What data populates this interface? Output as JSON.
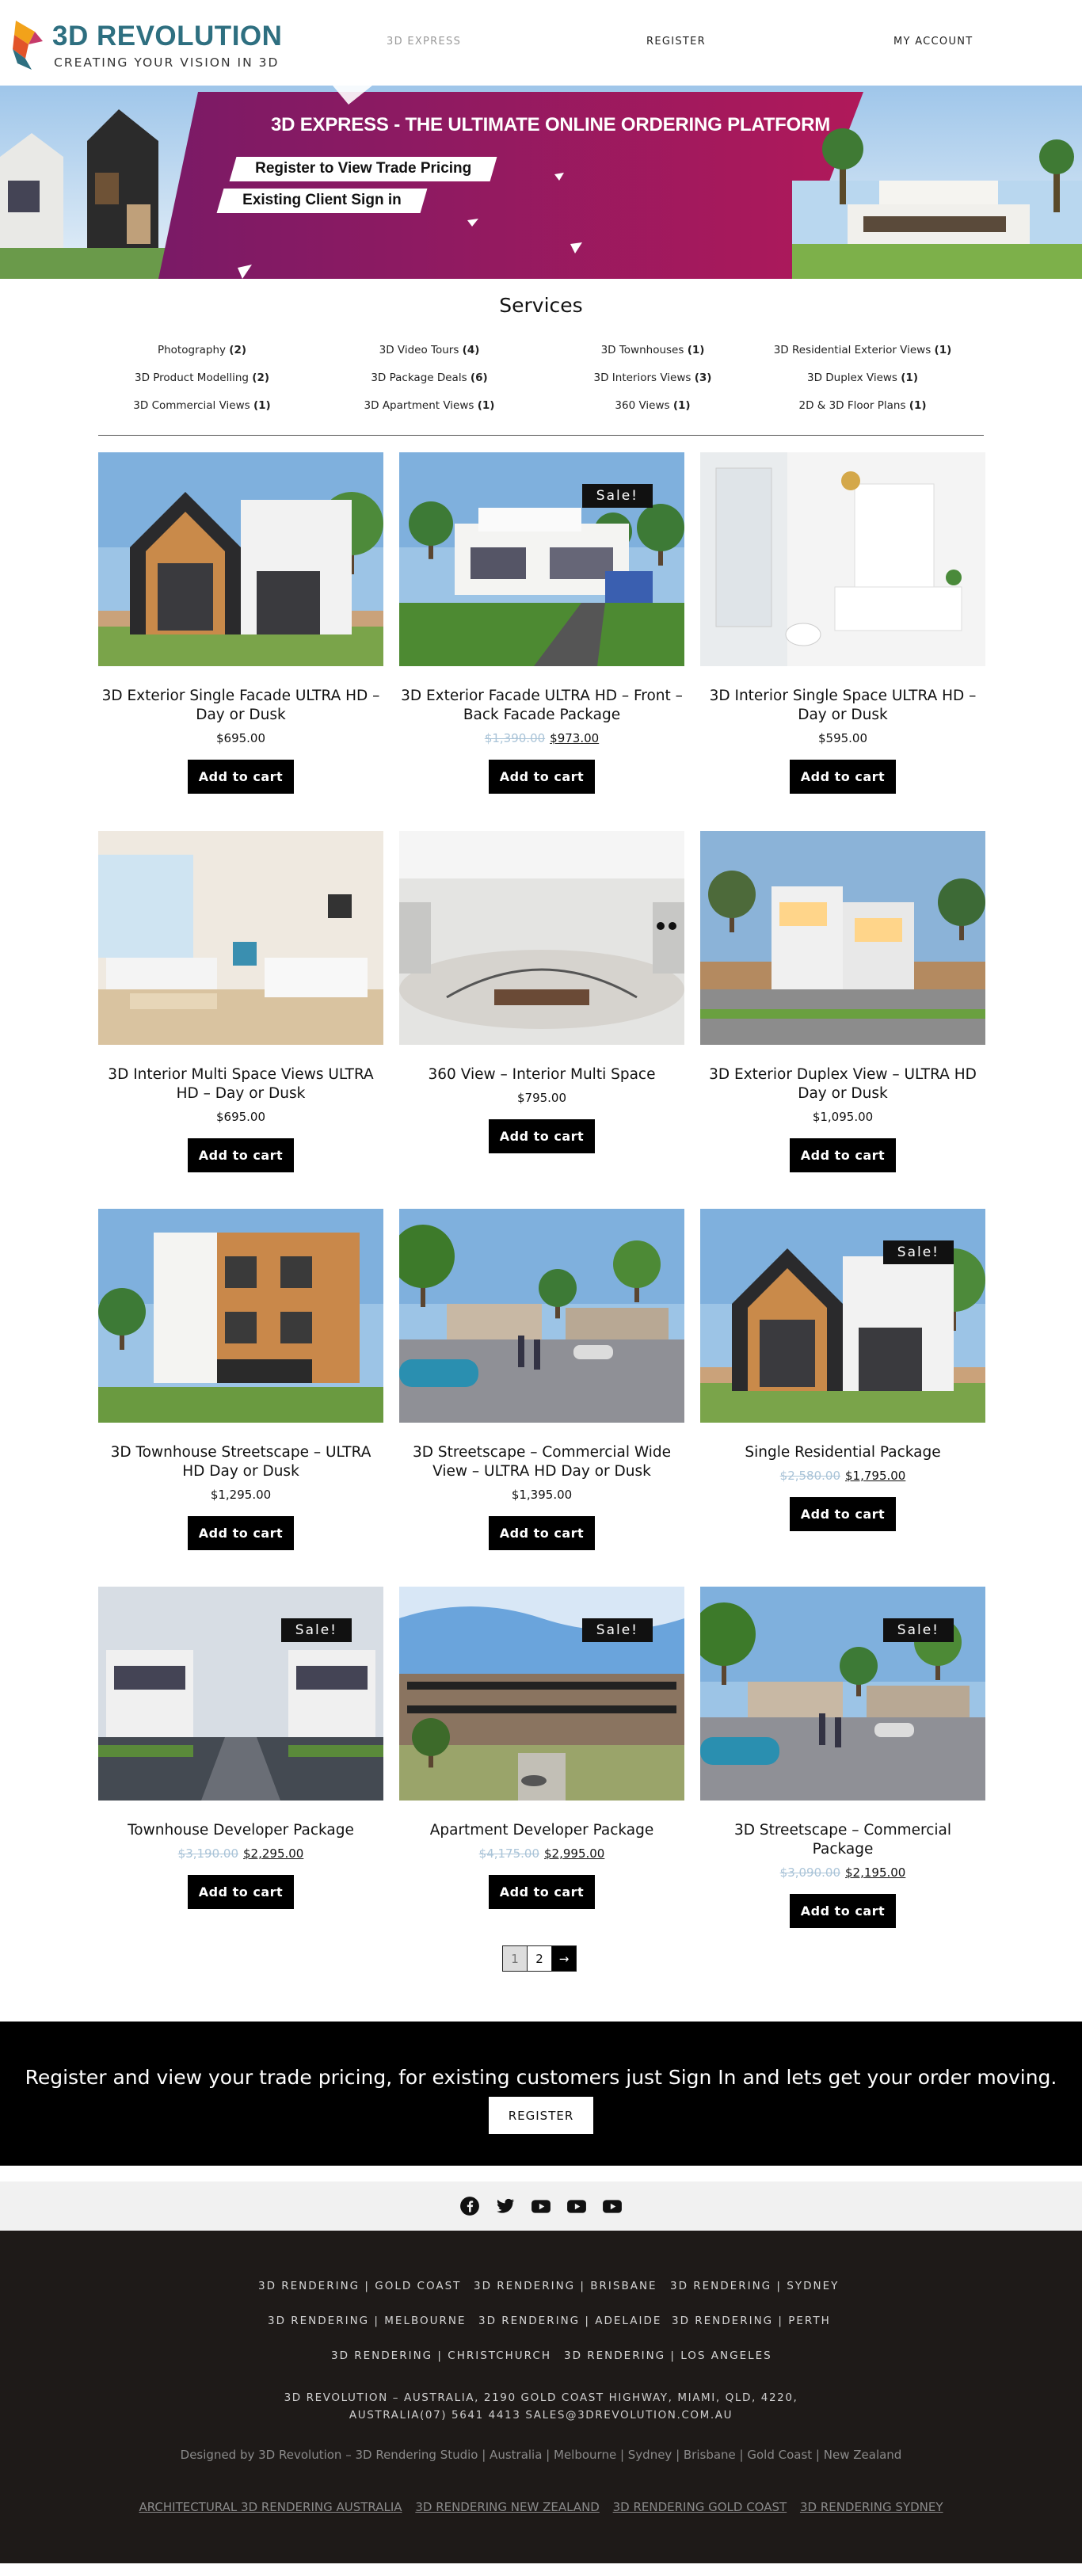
{
  "header": {
    "logo_title": "3D REVOLUTION",
    "logo_subtitle": "CREATING YOUR VISION IN 3D",
    "nav": [
      "3D EXPRESS",
      "REGISTER",
      "MY ACCOUNT"
    ]
  },
  "hero": {
    "title": "3D EXPRESS - THE ULTIMATE ONLINE ORDERING PLATFORM",
    "buttons": [
      "Register to View Trade Pricing",
      "Existing Client Sign in"
    ],
    "accent": "#a0175d"
  },
  "services": {
    "title": "Services",
    "items": [
      {
        "label": "Photography",
        "count": "(2)"
      },
      {
        "label": "3D Video Tours",
        "count": "(4)"
      },
      {
        "label": "3D Townhouses",
        "count": "(1)"
      },
      {
        "label": "3D Residential Exterior Views",
        "count": "(1)"
      },
      {
        "label": "3D Product Modelling",
        "count": "(2)"
      },
      {
        "label": "3D Package Deals",
        "count": "(6)"
      },
      {
        "label": "3D Interiors Views",
        "count": "(3)"
      },
      {
        "label": "3D Duplex Views",
        "count": "(1)"
      },
      {
        "label": "3D Commercial Views",
        "count": "(1)"
      },
      {
        "label": "3D Apartment Views",
        "count": "(1)"
      },
      {
        "label": "360 Views",
        "count": "(1)"
      },
      {
        "label": "2D & 3D Floor Plans",
        "count": "(1)"
      }
    ]
  },
  "products": [
    {
      "title": "3D Exterior Single Facade ULTRA HD – Day or Dusk",
      "price": "$695.00",
      "old_price": "",
      "sale": "",
      "button": "Add to cart",
      "image": "house-modern-gable"
    },
    {
      "title": "3D Exterior Facade ULTRA HD – Front – Back Facade Package",
      "price": "$973.00",
      "old_price": "$1,390.00",
      "sale": "Sale!",
      "button": "Add to cart",
      "image": "house-white-palms"
    },
    {
      "title": "3D Interior Single Space ULTRA HD – Day or Dusk",
      "price": "$595.00",
      "old_price": "",
      "sale": "",
      "button": "Add to cart",
      "image": "bathroom"
    },
    {
      "title": "3D Interior Multi Space Views ULTRA HD – Day or Dusk",
      "price": "$695.00",
      "old_price": "",
      "sale": "",
      "button": "Add to cart",
      "image": "living-room"
    },
    {
      "title": "360 View – Interior Multi Space",
      "price": "$795.00",
      "old_price": "",
      "sale": "",
      "button": "Add to cart",
      "image": "panorama-360"
    },
    {
      "title": "3D Exterior Duplex View – ULTRA HD Day or Dusk",
      "price": "$1,095.00",
      "old_price": "",
      "sale": "",
      "button": "Add to cart",
      "image": "duplex"
    },
    {
      "title": "3D Townhouse Streetscape – ULTRA HD Day or Dusk",
      "price": "$1,295.00",
      "old_price": "",
      "sale": "",
      "button": "Add to cart",
      "image": "townhouse-timber"
    },
    {
      "title": "3D Streetscape – Commercial Wide View – ULTRA HD Day or Dusk",
      "price": "$1,395.00",
      "old_price": "",
      "sale": "",
      "button": "Add to cart",
      "image": "streetscape"
    },
    {
      "title": "Single Residential Package",
      "price": "$1,795.00",
      "old_price": "$2,580.00",
      "sale": "Sale!",
      "button": "Add to cart",
      "image": "house-modern-gable"
    },
    {
      "title": "Townhouse Developer Package",
      "price": "$2,295.00",
      "old_price": "$3,190.00",
      "sale": "Sale!",
      "button": "Add to cart",
      "image": "townhouse-dev"
    },
    {
      "title": "Apartment Developer Package",
      "price": "$2,995.00",
      "old_price": "$4,175.00",
      "sale": "Sale!",
      "button": "Add to cart",
      "image": "apartment"
    },
    {
      "title": "3D Streetscape – Commercial Package",
      "price": "$2,195.00",
      "old_price": "$3,090.00",
      "sale": "Sale!",
      "button": "Add to cart",
      "image": "streetscape"
    }
  ],
  "pagination": {
    "pages": [
      "1",
      "2"
    ],
    "next": "→",
    "current": "1"
  },
  "cta": {
    "text": "Register and view your trade pricing, for existing customers just Sign In and lets get your order moving.",
    "button": "REGISTER"
  },
  "social": [
    "facebook-icon",
    "twitter-icon",
    "youtube-icon",
    "youtube-icon",
    "youtube-icon"
  ],
  "footer": {
    "rows": [
      [
        "3D RENDERING | GOLD COAST",
        "3D RENDERING | BRISBANE",
        "3D RENDERING | SYDNEY"
      ],
      [
        "3D RENDERING | MELBOURNE",
        "3D RENDERING | ADELAIDE",
        "3D RENDERING | PERTH"
      ],
      [
        "3D RENDERING | CHRISTCHURCH",
        "3D RENDERING | LOS ANGELES"
      ]
    ],
    "address_line1": "3D REVOLUTION – AUSTRALIA, 2190 GOLD COAST HIGHWAY, MIAMI, QLD, 4220,",
    "address_line2": "AUSTRALIA(07) 5641 4413 SALES@3DREVOLUTION.COM.AU",
    "designed_by": "Designed by 3D Revolution – 3D Rendering Studio | Australia | Melbourne | Sydney | Brisbane | Gold Coast | New Zealand",
    "bottom_links": [
      "ARCHITECTURAL 3D RENDERING AUSTRALIA",
      "3D RENDERING NEW ZEALAND",
      "3D RENDERING GOLD COAST",
      "3D RENDERING SYDNEY"
    ]
  }
}
